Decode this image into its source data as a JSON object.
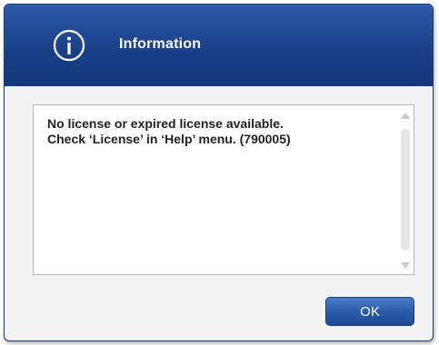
{
  "dialog": {
    "title": "Information",
    "message_line1": "No license or expired license available.",
    "message_line2": "Check ‘License’ in ‘Help’ menu. (790005)",
    "ok_label": "OK",
    "icon": "info-icon"
  },
  "colors": {
    "header": "#183f86",
    "button": "#2a5aa6",
    "background": "#f2f2f2"
  }
}
